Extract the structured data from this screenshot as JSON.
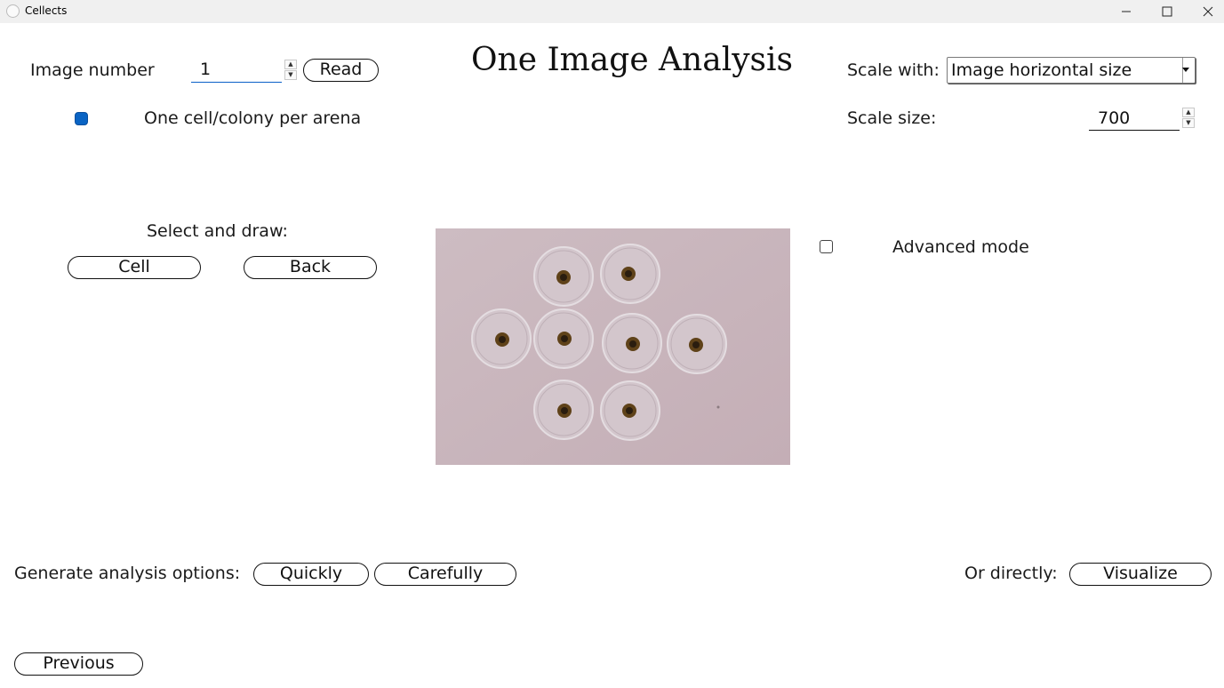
{
  "window": {
    "title": "Cellects"
  },
  "heading": "One Image Analysis",
  "image_number": {
    "label": "Image number",
    "value": "1",
    "read_label": "Read"
  },
  "one_cell": {
    "label": "One cell/colony per arena",
    "checked": true
  },
  "scale": {
    "with_label": "Scale with:",
    "with_value": "Image horizontal size",
    "size_label": "Scale size:",
    "size_value": "700"
  },
  "draw": {
    "label": "Select and draw:",
    "cell_label": "Cell",
    "back_label": "Back"
  },
  "advanced": {
    "label": "Advanced mode",
    "checked": false
  },
  "generate": {
    "label": "Generate analysis options:",
    "quickly_label": "Quickly",
    "carefully_label": "Carefully"
  },
  "direct": {
    "label": "Or directly:",
    "visualize_label": "Visualize"
  },
  "nav": {
    "previous_label": "Previous"
  },
  "colors": {
    "accent": "#0a64c4",
    "preview_bg": "#c9b6bd",
    "dish_rim": "#d9d0d6",
    "colony": "#6b4a1c"
  }
}
